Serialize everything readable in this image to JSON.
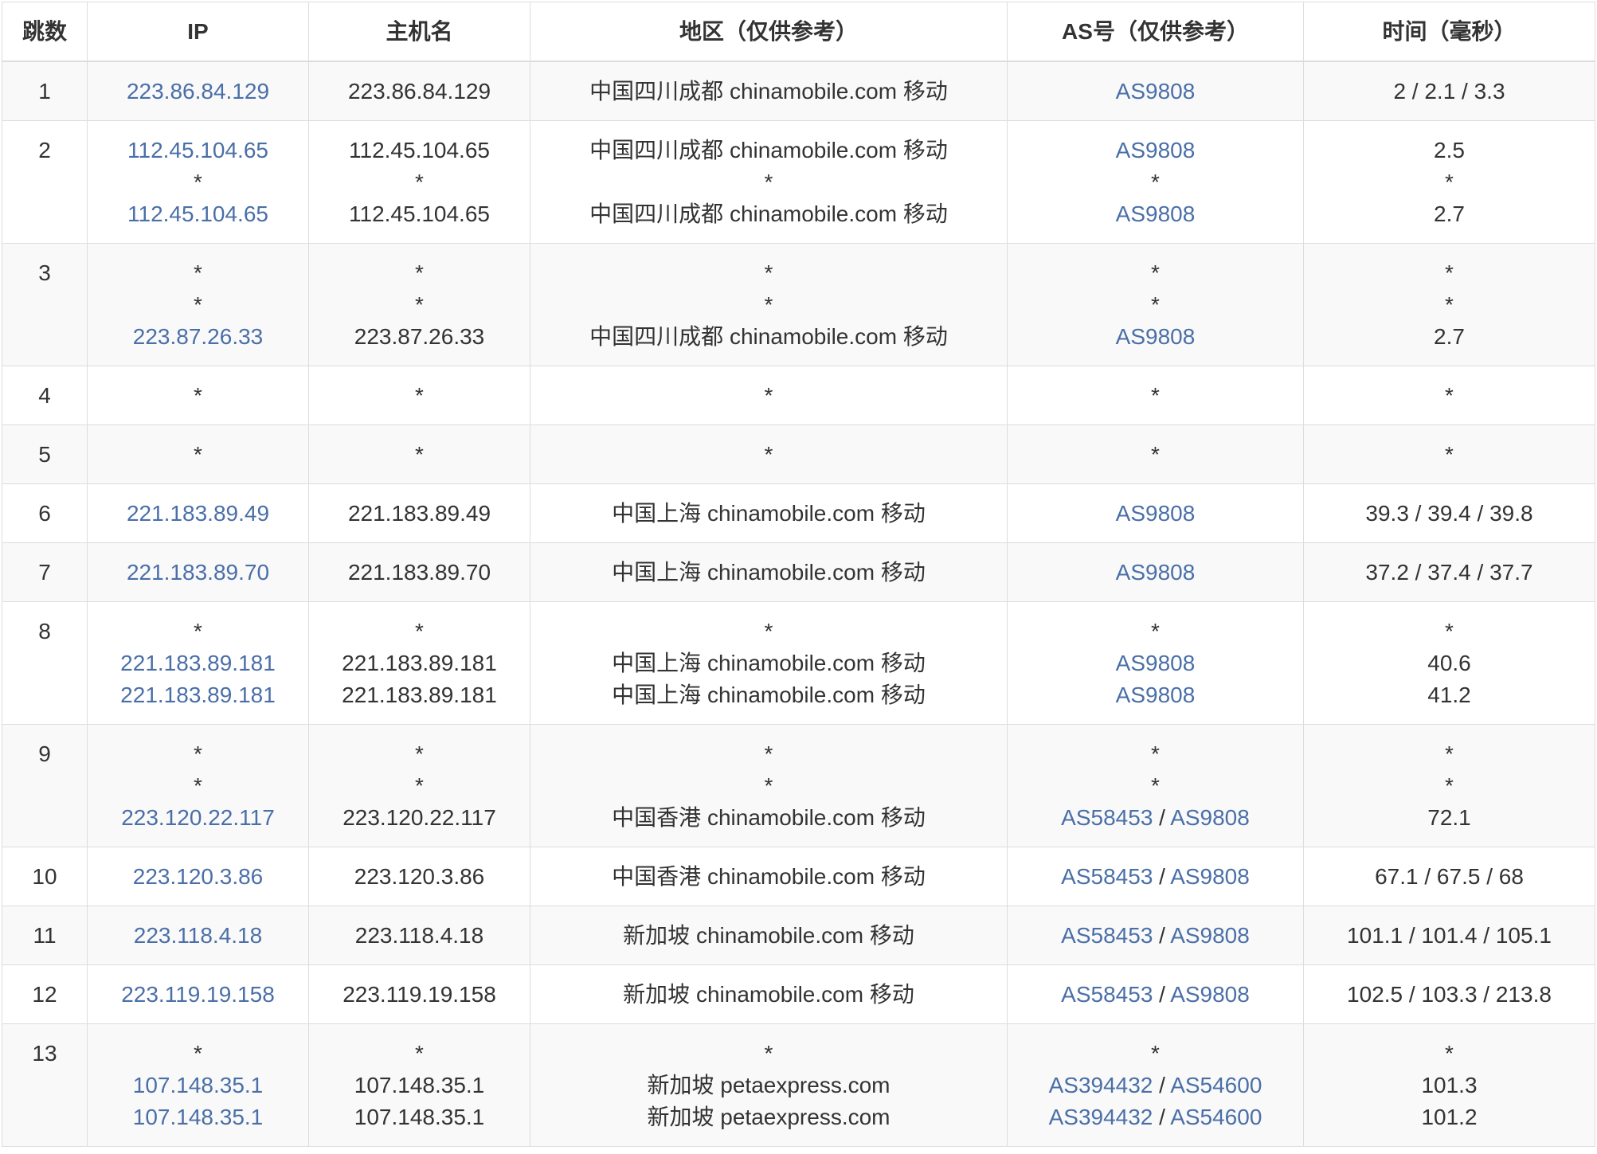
{
  "table": {
    "headers": {
      "hop": "跳数",
      "ip": "IP",
      "host": "主机名",
      "region": "地区（仅供参考）",
      "as": "AS号（仅供参考）",
      "time": "时间（毫秒）"
    },
    "as_separator": " / ",
    "hops": [
      {
        "hop": "1",
        "lines": [
          {
            "ip": "223.86.84.129",
            "host": "223.86.84.129",
            "region": "中国四川成都 chinamobile.com 移动",
            "as": [
              "AS9808"
            ],
            "time": "2 / 2.1 / 3.3"
          }
        ]
      },
      {
        "hop": "2",
        "lines": [
          {
            "ip": "112.45.104.65",
            "host": "112.45.104.65",
            "region": "中国四川成都 chinamobile.com 移动",
            "as": [
              "AS9808"
            ],
            "time": "2.5"
          },
          {
            "ip": "*",
            "host": "*",
            "region": "*",
            "as": [
              "*"
            ],
            "time": "*"
          },
          {
            "ip": "112.45.104.65",
            "host": "112.45.104.65",
            "region": "中国四川成都 chinamobile.com 移动",
            "as": [
              "AS9808"
            ],
            "time": "2.7"
          }
        ]
      },
      {
        "hop": "3",
        "lines": [
          {
            "ip": "*",
            "host": "*",
            "region": "*",
            "as": [
              "*"
            ],
            "time": "*"
          },
          {
            "ip": "*",
            "host": "*",
            "region": "*",
            "as": [
              "*"
            ],
            "time": "*"
          },
          {
            "ip": "223.87.26.33",
            "host": "223.87.26.33",
            "region": "中国四川成都 chinamobile.com 移动",
            "as": [
              "AS9808"
            ],
            "time": "2.7"
          }
        ]
      },
      {
        "hop": "4",
        "lines": [
          {
            "ip": "*",
            "host": "*",
            "region": "*",
            "as": [
              "*"
            ],
            "time": "*"
          }
        ]
      },
      {
        "hop": "5",
        "lines": [
          {
            "ip": "*",
            "host": "*",
            "region": "*",
            "as": [
              "*"
            ],
            "time": "*"
          }
        ]
      },
      {
        "hop": "6",
        "lines": [
          {
            "ip": "221.183.89.49",
            "host": "221.183.89.49",
            "region": "中国上海 chinamobile.com 移动",
            "as": [
              "AS9808"
            ],
            "time": "39.3 / 39.4 / 39.8"
          }
        ]
      },
      {
        "hop": "7",
        "lines": [
          {
            "ip": "221.183.89.70",
            "host": "221.183.89.70",
            "region": "中国上海 chinamobile.com 移动",
            "as": [
              "AS9808"
            ],
            "time": "37.2 / 37.4 / 37.7"
          }
        ]
      },
      {
        "hop": "8",
        "lines": [
          {
            "ip": "*",
            "host": "*",
            "region": "*",
            "as": [
              "*"
            ],
            "time": "*"
          },
          {
            "ip": "221.183.89.181",
            "host": "221.183.89.181",
            "region": "中国上海 chinamobile.com 移动",
            "as": [
              "AS9808"
            ],
            "time": "40.6"
          },
          {
            "ip": "221.183.89.181",
            "host": "221.183.89.181",
            "region": "中国上海 chinamobile.com 移动",
            "as": [
              "AS9808"
            ],
            "time": "41.2"
          }
        ]
      },
      {
        "hop": "9",
        "lines": [
          {
            "ip": "*",
            "host": "*",
            "region": "*",
            "as": [
              "*"
            ],
            "time": "*"
          },
          {
            "ip": "*",
            "host": "*",
            "region": "*",
            "as": [
              "*"
            ],
            "time": "*"
          },
          {
            "ip": "223.120.22.117",
            "host": "223.120.22.117",
            "region": "中国香港 chinamobile.com 移动",
            "as": [
              "AS58453",
              "AS9808"
            ],
            "time": "72.1"
          }
        ]
      },
      {
        "hop": "10",
        "lines": [
          {
            "ip": "223.120.3.86",
            "host": "223.120.3.86",
            "region": "中国香港 chinamobile.com 移动",
            "as": [
              "AS58453",
              "AS9808"
            ],
            "time": "67.1 / 67.5 / 68"
          }
        ]
      },
      {
        "hop": "11",
        "lines": [
          {
            "ip": "223.118.4.18",
            "host": "223.118.4.18",
            "region": "新加坡 chinamobile.com 移动",
            "as": [
              "AS58453",
              "AS9808"
            ],
            "time": "101.1 / 101.4 / 105.1"
          }
        ]
      },
      {
        "hop": "12",
        "lines": [
          {
            "ip": "223.119.19.158",
            "host": "223.119.19.158",
            "region": "新加坡 chinamobile.com 移动",
            "as": [
              "AS58453",
              "AS9808"
            ],
            "time": "102.5 / 103.3 / 213.8"
          }
        ]
      },
      {
        "hop": "13",
        "lines": [
          {
            "ip": "*",
            "host": "*",
            "region": "*",
            "as": [
              "*"
            ],
            "time": "*"
          },
          {
            "ip": "107.148.35.1",
            "host": "107.148.35.1",
            "region": "新加坡 petaexpress.com",
            "as": [
              "AS394432",
              "AS54600"
            ],
            "time": "101.3"
          },
          {
            "ip": "107.148.35.1",
            "host": "107.148.35.1",
            "region": "新加坡 petaexpress.com",
            "as": [
              "AS394432",
              "AS54600"
            ],
            "time": "101.2"
          }
        ]
      }
    ]
  },
  "colors": {
    "link": "#4a6fa8",
    "text": "#333333",
    "border": "#dddddd",
    "stripe": "#f9f9f9",
    "header_bg": "#ffffff"
  }
}
